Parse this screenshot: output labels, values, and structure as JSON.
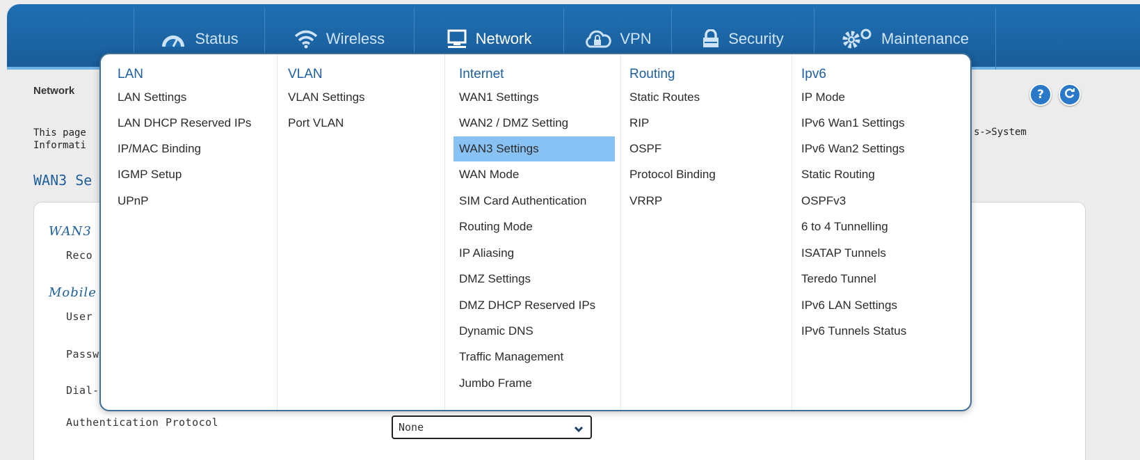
{
  "nav": {
    "items": [
      {
        "label": "Status",
        "icon": "gauge-icon"
      },
      {
        "label": "Wireless",
        "icon": "wifi-icon"
      },
      {
        "label": "Network",
        "icon": "monitor-icon"
      },
      {
        "label": "VPN",
        "icon": "cloud-lock-icon"
      },
      {
        "label": "Security",
        "icon": "lock-icon"
      },
      {
        "label": "Maintenance",
        "icon": "gears-icon"
      }
    ],
    "active": "Network"
  },
  "breadcrumb": "Network",
  "help_button": "?",
  "description": {
    "line1": "This page",
    "line2": "Informati",
    "right": "s->System"
  },
  "page_title": "WAN3 Se",
  "form": {
    "section1": "WAN3 ",
    "recon_label": "Reco",
    "section2": "Mobile",
    "user_label": "User",
    "pass_label": "Passw",
    "dial_label": "Dial-",
    "auth_label": "Authentication Protocol",
    "auth_value": "None"
  },
  "menu": {
    "lan": {
      "heading": "LAN",
      "items": [
        "LAN Settings",
        "LAN DHCP Reserved IPs",
        "IP/MAC Binding",
        "IGMP Setup",
        "UPnP"
      ]
    },
    "vlan": {
      "heading": "VLAN",
      "items": [
        "VLAN Settings",
        "Port VLAN"
      ]
    },
    "internet": {
      "heading": "Internet",
      "items": [
        "WAN1 Settings",
        "WAN2 / DMZ Setting",
        "WAN3 Settings",
        "WAN Mode",
        "SIM Card Authentication",
        "Routing Mode",
        "IP Aliasing",
        "DMZ Settings",
        "DMZ DHCP Reserved IPs",
        "Dynamic DNS",
        "Traffic Management",
        "Jumbo Frame"
      ],
      "selected": "WAN3 Settings"
    },
    "routing": {
      "heading": "Routing",
      "items": [
        "Static Routes",
        "RIP",
        "OSPF",
        "Protocol Binding",
        "VRRP"
      ]
    },
    "ipv6": {
      "heading": "Ipv6",
      "items": [
        "IP Mode",
        "IPv6 Wan1 Settings",
        "IPv6 Wan2 Settings",
        "Static Routing",
        "OSPFv3",
        "6 to 4 Tunnelling",
        "ISATAP Tunnels",
        "Teredo Tunnel",
        "IPv6 LAN Settings",
        "IPv6 Tunnels Status"
      ]
    }
  },
  "colors": {
    "header": "#1f6fb3",
    "accent": "#1d5fa0",
    "selected": "#88c2f4"
  }
}
